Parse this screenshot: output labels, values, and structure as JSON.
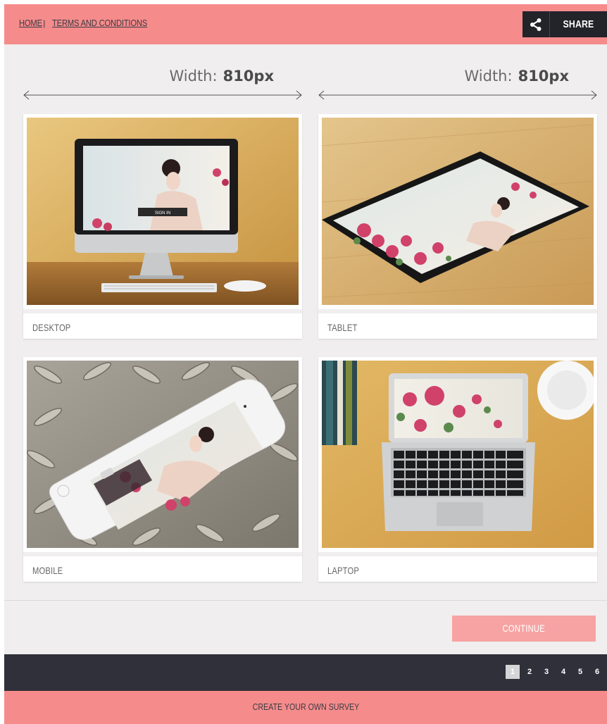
{
  "breadcrumb": {
    "home": "HOME",
    "separator": "|",
    "current": "TERMS AND CONDITIONS"
  },
  "share": {
    "icon": "share-icon",
    "label": "SHARE"
  },
  "width_indicators": [
    {
      "label": "Width:",
      "value": "810px"
    },
    {
      "label": "Width:",
      "value": "810px"
    }
  ],
  "cards": [
    {
      "label": "DESKTOP",
      "image": "desktop-monitor-photo"
    },
    {
      "label": "TABLET",
      "image": "tablet-photo"
    },
    {
      "label": "MOBILE",
      "image": "smartphone-photo"
    },
    {
      "label": "LAPTOP",
      "image": "laptop-photo"
    }
  ],
  "desktop_screen_button": "SIGN IN",
  "continue_label": "CONTINUE",
  "pagination": {
    "pages": [
      "1",
      "2",
      "3",
      "4",
      "5",
      "6"
    ],
    "current": "1"
  },
  "footer": {
    "label": "CREATE YOUR OWN SURVEY"
  },
  "colors": {
    "accent": "#f58b8b",
    "dark": "#2f3039",
    "background": "#f0eeee",
    "continue": "#f7a3a3"
  }
}
